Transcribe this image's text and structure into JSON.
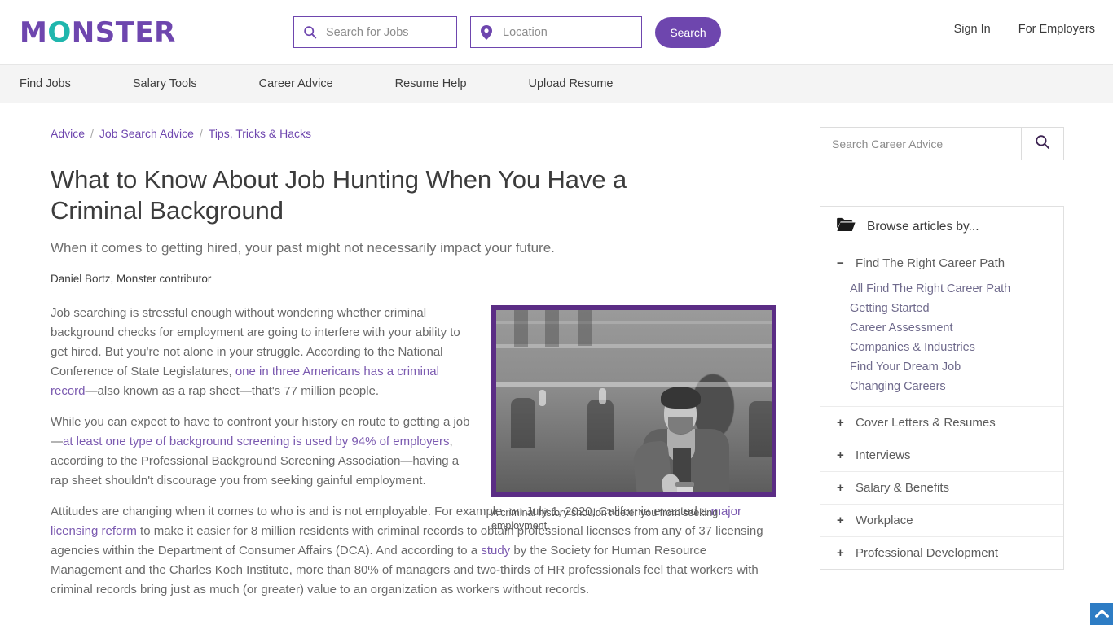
{
  "header": {
    "logo_text": "MONSTER",
    "logo_purple": "#6e46ae",
    "logo_teal": "#1fb6ad",
    "job_search": {
      "value": "",
      "placeholder": "Search for Jobs"
    },
    "location_search": {
      "value": "",
      "placeholder": "Location"
    },
    "search_button": "Search",
    "sign_in": "Sign In",
    "for_employers": "For Employers"
  },
  "nav": {
    "items": [
      {
        "label": "Find Jobs"
      },
      {
        "label": "Salary Tools"
      },
      {
        "label": "Career Advice"
      },
      {
        "label": "Resume Help"
      },
      {
        "label": "Upload Resume"
      }
    ]
  },
  "breadcrumb": {
    "items": [
      {
        "label": "Advice"
      },
      {
        "label": "Job Search Advice"
      },
      {
        "label": "Tips, Tricks & Hacks"
      }
    ],
    "separator": "/"
  },
  "article": {
    "title": "What to Know About Job Hunting When You Have a Criminal Background",
    "subtitle": "When it comes to getting hired, your past might not necessarily impact your future.",
    "byline": "Daniel Bortz, Monster contributor",
    "p1_a": "Job searching is stressful enough without wondering whether criminal background checks for employment are going to interfere with your ability to get hired. But you're not alone in your struggle. According to the National Conference of State Legislatures, ",
    "p1_link": "one in three Americans has a criminal record",
    "p1_b": "—also known as a rap sheet—that's 77 million people.",
    "p2_a": "While you can expect to have to confront your history en route to getting a job—",
    "p2_link": "at least one type of background screening is used by 94% of employers",
    "p2_b": ", according to the Professional Background Screening Association—having a rap sheet shouldn't discourage you from seeking gainful employment.",
    "p3_a": "Attitudes are changing when it comes to who is and is not employable. For example, on July 1, 2020, California enacted a ",
    "p3_link1": "major licensing reform",
    "p3_b": " to make it easier for 8 million residents with criminal records to obtain professional licenses from any of 37 licensing agencies within the Department of Consumer Affairs (DCA). And according to a ",
    "p3_link2": "study",
    "p3_c": " by the Society for Human Resource Management and the Charles Koch Institute, more than 80% of managers and two-thirds of HR professionals feel that workers with criminal records bring just as much (or greater) value to an organization as workers without records.",
    "image_caption": "A criminal history shouldn't deter you from seeking employment.",
    "image_border_color": "#5b2d85"
  },
  "rail": {
    "search": {
      "value": "",
      "placeholder": "Search Career Advice"
    },
    "browse_title": "Browse articles by...",
    "sections": [
      {
        "label": "Find The Right Career Path",
        "sign": "−",
        "expanded": true,
        "links": [
          "All Find The Right Career Path",
          "Getting Started",
          "Career Assessment",
          "Companies & Industries",
          "Find Your Dream Job",
          "Changing Careers"
        ]
      },
      {
        "label": "Cover Letters & Resumes",
        "sign": "+",
        "expanded": false,
        "links": []
      },
      {
        "label": "Interviews",
        "sign": "+",
        "expanded": false,
        "links": []
      },
      {
        "label": "Salary & Benefits",
        "sign": "+",
        "expanded": false,
        "links": []
      },
      {
        "label": "Workplace",
        "sign": "+",
        "expanded": false,
        "links": []
      },
      {
        "label": "Professional Development",
        "sign": "+",
        "expanded": false,
        "links": []
      }
    ]
  },
  "scroll_top": {
    "icon": "chevron-up-icon",
    "color": "#2d7cc4"
  }
}
